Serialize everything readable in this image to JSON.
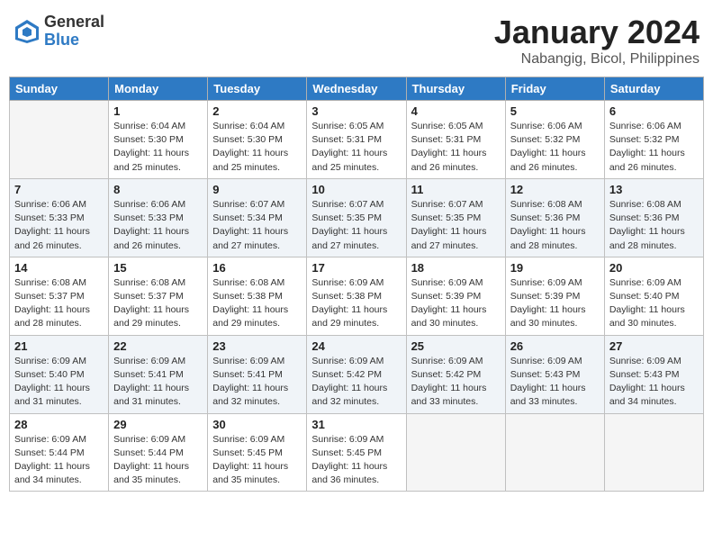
{
  "header": {
    "logo_general": "General",
    "logo_blue": "Blue",
    "month_year": "January 2024",
    "location": "Nabangig, Bicol, Philippines"
  },
  "days_of_week": [
    "Sunday",
    "Monday",
    "Tuesday",
    "Wednesday",
    "Thursday",
    "Friday",
    "Saturday"
  ],
  "weeks": [
    [
      {
        "day": null
      },
      {
        "day": 1,
        "sunrise": "Sunrise: 6:04 AM",
        "sunset": "Sunset: 5:30 PM",
        "daylight": "Daylight: 11 hours and 25 minutes."
      },
      {
        "day": 2,
        "sunrise": "Sunrise: 6:04 AM",
        "sunset": "Sunset: 5:30 PM",
        "daylight": "Daylight: 11 hours and 25 minutes."
      },
      {
        "day": 3,
        "sunrise": "Sunrise: 6:05 AM",
        "sunset": "Sunset: 5:31 PM",
        "daylight": "Daylight: 11 hours and 25 minutes."
      },
      {
        "day": 4,
        "sunrise": "Sunrise: 6:05 AM",
        "sunset": "Sunset: 5:31 PM",
        "daylight": "Daylight: 11 hours and 26 minutes."
      },
      {
        "day": 5,
        "sunrise": "Sunrise: 6:06 AM",
        "sunset": "Sunset: 5:32 PM",
        "daylight": "Daylight: 11 hours and 26 minutes."
      },
      {
        "day": 6,
        "sunrise": "Sunrise: 6:06 AM",
        "sunset": "Sunset: 5:32 PM",
        "daylight": "Daylight: 11 hours and 26 minutes."
      }
    ],
    [
      {
        "day": 7,
        "sunrise": "Sunrise: 6:06 AM",
        "sunset": "Sunset: 5:33 PM",
        "daylight": "Daylight: 11 hours and 26 minutes."
      },
      {
        "day": 8,
        "sunrise": "Sunrise: 6:06 AM",
        "sunset": "Sunset: 5:33 PM",
        "daylight": "Daylight: 11 hours and 26 minutes."
      },
      {
        "day": 9,
        "sunrise": "Sunrise: 6:07 AM",
        "sunset": "Sunset: 5:34 PM",
        "daylight": "Daylight: 11 hours and 27 minutes."
      },
      {
        "day": 10,
        "sunrise": "Sunrise: 6:07 AM",
        "sunset": "Sunset: 5:35 PM",
        "daylight": "Daylight: 11 hours and 27 minutes."
      },
      {
        "day": 11,
        "sunrise": "Sunrise: 6:07 AM",
        "sunset": "Sunset: 5:35 PM",
        "daylight": "Daylight: 11 hours and 27 minutes."
      },
      {
        "day": 12,
        "sunrise": "Sunrise: 6:08 AM",
        "sunset": "Sunset: 5:36 PM",
        "daylight": "Daylight: 11 hours and 28 minutes."
      },
      {
        "day": 13,
        "sunrise": "Sunrise: 6:08 AM",
        "sunset": "Sunset: 5:36 PM",
        "daylight": "Daylight: 11 hours and 28 minutes."
      }
    ],
    [
      {
        "day": 14,
        "sunrise": "Sunrise: 6:08 AM",
        "sunset": "Sunset: 5:37 PM",
        "daylight": "Daylight: 11 hours and 28 minutes."
      },
      {
        "day": 15,
        "sunrise": "Sunrise: 6:08 AM",
        "sunset": "Sunset: 5:37 PM",
        "daylight": "Daylight: 11 hours and 29 minutes."
      },
      {
        "day": 16,
        "sunrise": "Sunrise: 6:08 AM",
        "sunset": "Sunset: 5:38 PM",
        "daylight": "Daylight: 11 hours and 29 minutes."
      },
      {
        "day": 17,
        "sunrise": "Sunrise: 6:09 AM",
        "sunset": "Sunset: 5:38 PM",
        "daylight": "Daylight: 11 hours and 29 minutes."
      },
      {
        "day": 18,
        "sunrise": "Sunrise: 6:09 AM",
        "sunset": "Sunset: 5:39 PM",
        "daylight": "Daylight: 11 hours and 30 minutes."
      },
      {
        "day": 19,
        "sunrise": "Sunrise: 6:09 AM",
        "sunset": "Sunset: 5:39 PM",
        "daylight": "Daylight: 11 hours and 30 minutes."
      },
      {
        "day": 20,
        "sunrise": "Sunrise: 6:09 AM",
        "sunset": "Sunset: 5:40 PM",
        "daylight": "Daylight: 11 hours and 30 minutes."
      }
    ],
    [
      {
        "day": 21,
        "sunrise": "Sunrise: 6:09 AM",
        "sunset": "Sunset: 5:40 PM",
        "daylight": "Daylight: 11 hours and 31 minutes."
      },
      {
        "day": 22,
        "sunrise": "Sunrise: 6:09 AM",
        "sunset": "Sunset: 5:41 PM",
        "daylight": "Daylight: 11 hours and 31 minutes."
      },
      {
        "day": 23,
        "sunrise": "Sunrise: 6:09 AM",
        "sunset": "Sunset: 5:41 PM",
        "daylight": "Daylight: 11 hours and 32 minutes."
      },
      {
        "day": 24,
        "sunrise": "Sunrise: 6:09 AM",
        "sunset": "Sunset: 5:42 PM",
        "daylight": "Daylight: 11 hours and 32 minutes."
      },
      {
        "day": 25,
        "sunrise": "Sunrise: 6:09 AM",
        "sunset": "Sunset: 5:42 PM",
        "daylight": "Daylight: 11 hours and 33 minutes."
      },
      {
        "day": 26,
        "sunrise": "Sunrise: 6:09 AM",
        "sunset": "Sunset: 5:43 PM",
        "daylight": "Daylight: 11 hours and 33 minutes."
      },
      {
        "day": 27,
        "sunrise": "Sunrise: 6:09 AM",
        "sunset": "Sunset: 5:43 PM",
        "daylight": "Daylight: 11 hours and 34 minutes."
      }
    ],
    [
      {
        "day": 28,
        "sunrise": "Sunrise: 6:09 AM",
        "sunset": "Sunset: 5:44 PM",
        "daylight": "Daylight: 11 hours and 34 minutes."
      },
      {
        "day": 29,
        "sunrise": "Sunrise: 6:09 AM",
        "sunset": "Sunset: 5:44 PM",
        "daylight": "Daylight: 11 hours and 35 minutes."
      },
      {
        "day": 30,
        "sunrise": "Sunrise: 6:09 AM",
        "sunset": "Sunset: 5:45 PM",
        "daylight": "Daylight: 11 hours and 35 minutes."
      },
      {
        "day": 31,
        "sunrise": "Sunrise: 6:09 AM",
        "sunset": "Sunset: 5:45 PM",
        "daylight": "Daylight: 11 hours and 36 minutes."
      },
      {
        "day": null
      },
      {
        "day": null
      },
      {
        "day": null
      }
    ]
  ]
}
